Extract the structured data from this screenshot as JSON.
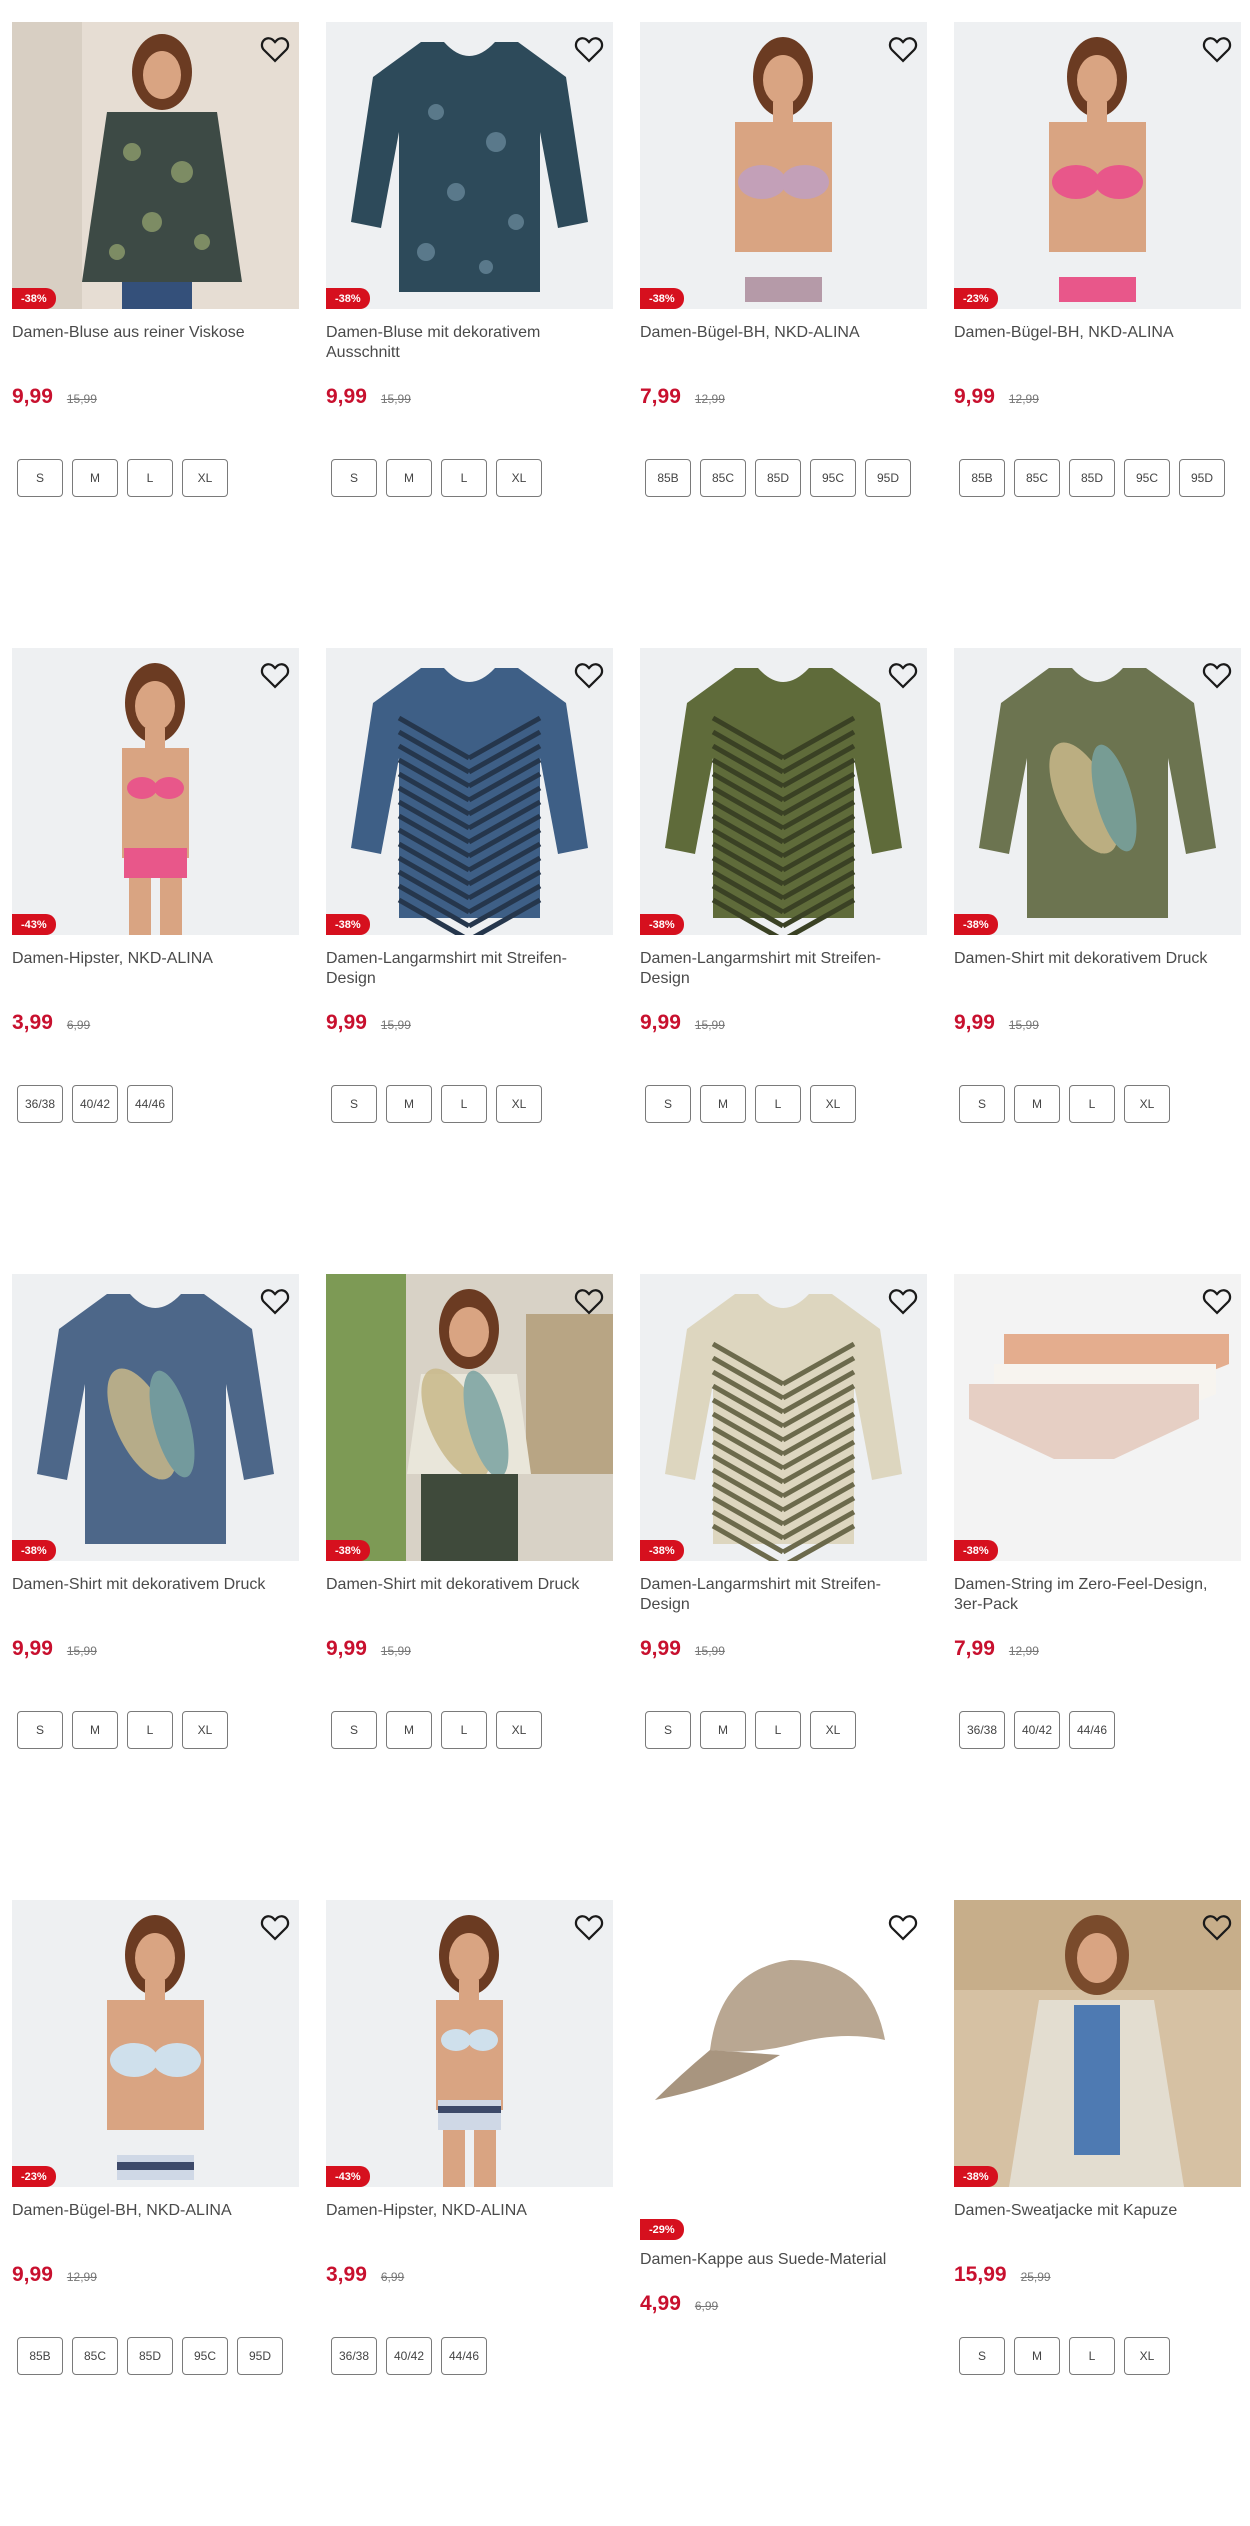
{
  "products": [
    {
      "title": "Damen-Bluse aus reiner Viskose",
      "discount": "-38%",
      "price": "9,99",
      "old_price": "15,99",
      "sizes": [
        "S",
        "M",
        "L",
        "XL"
      ],
      "art": "blouse1"
    },
    {
      "title": "Damen-Bluse mit dekorativem Ausschnitt",
      "discount": "-38%",
      "price": "9,99",
      "old_price": "15,99",
      "sizes": [
        "S",
        "M",
        "L",
        "XL"
      ],
      "art": "blouse2"
    },
    {
      "title": "Damen-Bügel-BH, NKD-ALINA",
      "discount": "-38%",
      "price": "7,99",
      "old_price": "12,99",
      "sizes": [
        "85B",
        "85C",
        "85D",
        "95C",
        "95D"
      ],
      "art": "bra-lilac"
    },
    {
      "title": "Damen-Bügel-BH, NKD-ALINA",
      "discount": "-23%",
      "price": "9,99",
      "old_price": "12,99",
      "sizes": [
        "85B",
        "85C",
        "85D",
        "95C",
        "95D"
      ],
      "art": "bra-pink"
    },
    {
      "title": "Damen-Hipster, NKD-ALINA",
      "discount": "-43%",
      "price": "3,99",
      "old_price": "6,99",
      "sizes": [
        "36/38",
        "40/42",
        "44/46"
      ],
      "art": "hipster-pink"
    },
    {
      "title": "Damen-Langarmshirt mit Streifen-Design",
      "discount": "-38%",
      "price": "9,99",
      "old_price": "15,99",
      "sizes": [
        "S",
        "M",
        "L",
        "XL"
      ],
      "art": "stripe-blue"
    },
    {
      "title": "Damen-Langarmshirt mit Streifen-Design",
      "discount": "-38%",
      "price": "9,99",
      "old_price": "15,99",
      "sizes": [
        "S",
        "M",
        "L",
        "XL"
      ],
      "art": "stripe-olive"
    },
    {
      "title": "Damen-Shirt mit dekorativem Druck",
      "discount": "-38%",
      "price": "9,99",
      "old_price": "15,99",
      "sizes": [
        "S",
        "M",
        "L",
        "XL"
      ],
      "art": "print-olive"
    },
    {
      "title": "Damen-Shirt mit dekorativem Druck",
      "discount": "-38%",
      "price": "9,99",
      "old_price": "15,99",
      "sizes": [
        "S",
        "M",
        "L",
        "XL"
      ],
      "art": "print-blue"
    },
    {
      "title": "Damen-Shirt mit dekorativem Druck",
      "discount": "-38%",
      "price": "9,99",
      "old_price": "15,99",
      "sizes": [
        "S",
        "M",
        "L",
        "XL"
      ],
      "art": "print-model"
    },
    {
      "title": "Damen-Langarmshirt mit Streifen-Design",
      "discount": "-38%",
      "price": "9,99",
      "old_price": "15,99",
      "sizes": [
        "S",
        "M",
        "L",
        "XL"
      ],
      "art": "stripe-beige"
    },
    {
      "title": "Damen-String im Zero-Feel-Design, 3er-Pack",
      "discount": "-38%",
      "price": "7,99",
      "old_price": "12,99",
      "sizes": [
        "36/38",
        "40/42",
        "44/46"
      ],
      "art": "strings"
    },
    {
      "title": "Damen-Bügel-BH, NKD-ALINA",
      "discount": "-23%",
      "price": "9,99",
      "old_price": "12,99",
      "sizes": [
        "85B",
        "85C",
        "85D",
        "95C",
        "95D"
      ],
      "art": "bra-blue"
    },
    {
      "title": "Damen-Hipster, NKD-ALINA",
      "discount": "-43%",
      "price": "3,99",
      "old_price": "6,99",
      "sizes": [
        "36/38",
        "40/42",
        "44/46"
      ],
      "art": "hipster-blue"
    },
    {
      "title": "Damen-Kappe aus Suede-Material",
      "discount": "-29%",
      "price": "4,99",
      "old_price": "6,99",
      "sizes": [],
      "art": "cap",
      "badge_below": true
    },
    {
      "title": "Damen-Sweatjacke mit Kapuze",
      "discount": "-38%",
      "price": "15,99",
      "old_price": "25,99",
      "sizes": [
        "S",
        "M",
        "L",
        "XL"
      ],
      "art": "jacket"
    }
  ],
  "colors": {
    "accent": "#c8102e",
    "badge": "#d6101e"
  },
  "icons": {
    "wishlist": "heart-outline-icon"
  }
}
